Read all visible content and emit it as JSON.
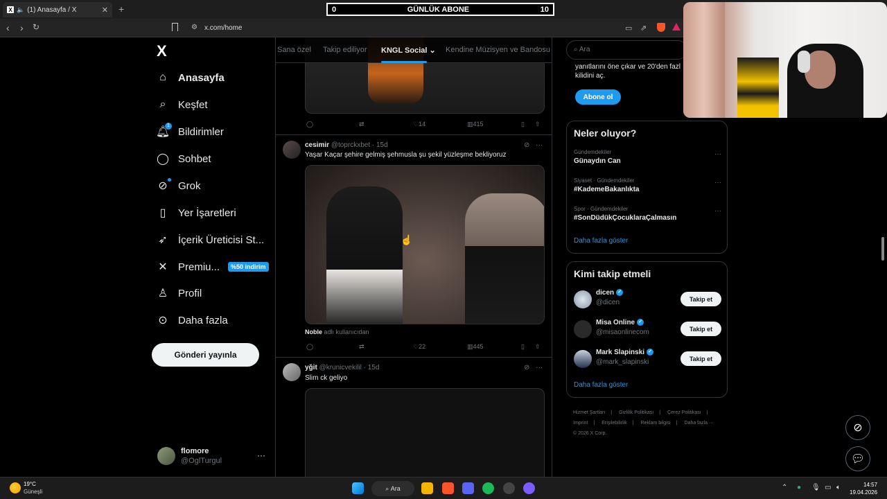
{
  "browser": {
    "tab_title": "(1) Anasayfa / X",
    "tab_favicon": "X",
    "new_tab": "+",
    "url": "x.com/home"
  },
  "overlay": {
    "label": "GÜNLÜK ABONE",
    "min": "0",
    "max": "10"
  },
  "nav": {
    "logo": "X",
    "items": [
      {
        "label": "Anasayfa",
        "icon": "home-icon"
      },
      {
        "label": "Keşfet",
        "icon": "search-icon"
      },
      {
        "label": "Bildirimler",
        "icon": "bell-icon",
        "badge": "1"
      },
      {
        "label": "Sohbet",
        "icon": "chat-icon"
      },
      {
        "label": "Grok",
        "icon": "grok-icon"
      },
      {
        "label": "Yer İşaretleri",
        "icon": "bookmark-icon"
      },
      {
        "label": "İçerik Üreticisi St...",
        "icon": "rocket-icon"
      },
      {
        "label": "Premiu...",
        "icon": "x-premium-icon",
        "badge": "%50 indirim"
      },
      {
        "label": "Profil",
        "icon": "person-icon"
      },
      {
        "label": "Daha fazla",
        "icon": "more-circle-icon"
      }
    ],
    "post_button": "Gönderi yayınla",
    "user": {
      "name": "flomore",
      "handle": "@OglTurgul",
      "more": "···"
    }
  },
  "feed_tabs": [
    {
      "label": "Sana özel"
    },
    {
      "label": "Takip ediliyor"
    },
    {
      "label": "KNGL Social ⌄",
      "active": true
    },
    {
      "label": "Kendine Müzisyen ve Bandosu"
    }
  ],
  "tweets": [
    {
      "stats": {
        "replies": "",
        "retweets": "",
        "likes": "14",
        "views": "415"
      }
    },
    {
      "name": "cesimir",
      "handle": "@toprckxbet",
      "time": "· 15d",
      "text": "Yaşar Kaçar şehire gelmiş şehmusla şu şekil yüzleşme bekliyoruz",
      "attribution_name": "Noble",
      "attribution_rest": " adlı kullanıcıdan",
      "stats": {
        "replies": "",
        "retweets": "",
        "likes": "22",
        "views": "445"
      }
    },
    {
      "name": "yğit",
      "handle": "@krunicvekilil",
      "time": "· 15d",
      "text": "Slim ck geliyo"
    }
  ],
  "right": {
    "search_placeholder": "Ara",
    "subscribe_text": "yanıtlarını öne çıkar ve 20'den fazl kilidini aç.",
    "subscribe_button": "Abone ol",
    "trends_title": "Neler oluyor?",
    "trends": [
      {
        "category": "Gündemdekiler",
        "title": "Günaydın Can"
      },
      {
        "category": "Siyaset · Gündemdekiler",
        "title": "#KademeBakanlıkta"
      },
      {
        "category": "Spor · Gündemdekiler",
        "title": "#SonDüdükÇocuklaraÇalmasın"
      }
    ],
    "trends_more": "Daha fazla göster",
    "who_title": "Kimi takip etmeli",
    "who": [
      {
        "name": "dicen",
        "handle": "@dicen",
        "button": "Takip et"
      },
      {
        "name": "Misa Online",
        "handle": "@misaonlinecom",
        "button": "Takip et"
      },
      {
        "name": "Mark Slapinski",
        "handle": "@mark_slapinski",
        "button": "Takip et"
      }
    ],
    "who_more": "Daha fazla göster",
    "footer": [
      "Hizmet Şartları",
      "|",
      "Gizlilik Politikası",
      "|",
      "Çerez Politikası",
      "|",
      "Imprint",
      "|",
      "Erişilebilirlik",
      "|",
      "Reklam bilgisi",
      "|",
      "Daha fazla ···",
      "© 2026 X Corp."
    ]
  },
  "taskbar": {
    "temp": "19°C",
    "weather": "Güneşli",
    "search": "Ara",
    "time": "14:57",
    "date": "19.04.2026"
  },
  "colors": {
    "accent": "#1d9bf0",
    "bg": "#000000",
    "border": "#2f3336",
    "muted": "#71767b"
  }
}
